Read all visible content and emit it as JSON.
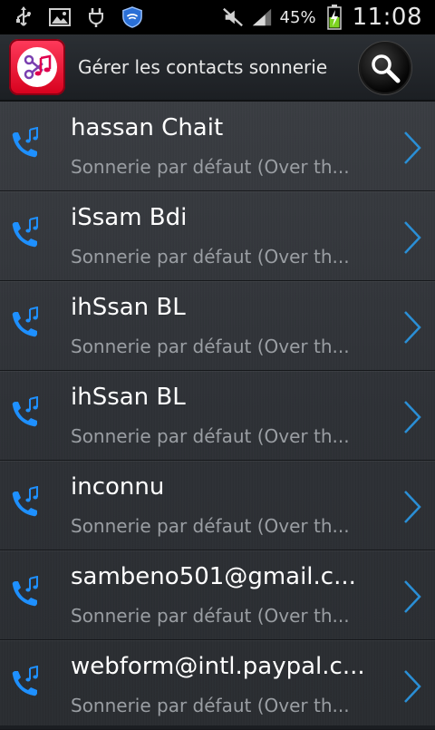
{
  "status_bar": {
    "icons": [
      "usb-icon",
      "image-icon",
      "plug-icon",
      "shield-icon",
      "mute-icon",
      "signal-icon",
      "battery-icon"
    ],
    "battery": "45%",
    "time": "11:08"
  },
  "action_bar": {
    "title": "Gérer les contacts sonnerie",
    "app_icon": "ringtone-scissors-icon",
    "search_icon": "search-icon"
  },
  "contacts": [
    {
      "name": "hassan Chait",
      "ringtone": "Sonnerie par défaut (Over th..."
    },
    {
      "name": "iSsam Bdi",
      "ringtone": "Sonnerie par défaut (Over th..."
    },
    {
      "name": "ihSsan BL",
      "ringtone": "Sonnerie par défaut (Over th..."
    },
    {
      "name": "ihSsan BL",
      "ringtone": "Sonnerie par défaut (Over th..."
    },
    {
      "name": "inconnu",
      "ringtone": "Sonnerie par défaut (Over th..."
    },
    {
      "name": "sambeno501@gmail.c...",
      "ringtone": "Sonnerie par défaut (Over th..."
    },
    {
      "name": "webform@intl.paypal.c...",
      "ringtone": "Sonnerie par défaut (Over th..."
    }
  ],
  "colors": {
    "accent_blue": "#1e90ff",
    "chevron_blue": "#2a8fd6",
    "name_text": "#ffffff",
    "sub_text": "#9a9ea3"
  }
}
